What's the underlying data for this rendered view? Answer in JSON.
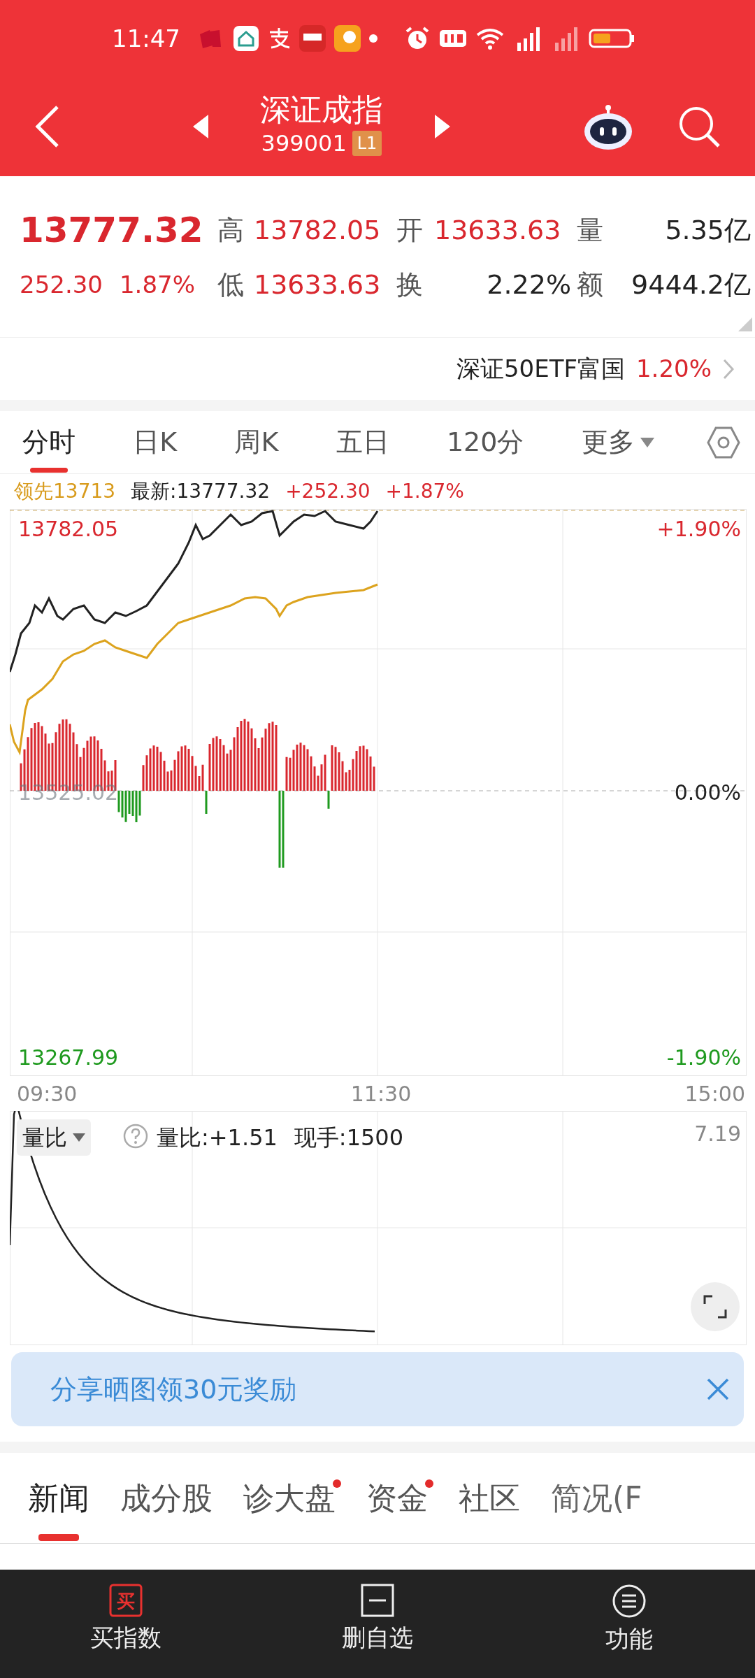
{
  "status_bar": {
    "time": "11:47"
  },
  "header": {
    "title": "深证成指",
    "code": "399001",
    "level_badge": "L1"
  },
  "quote": {
    "price": "13777.32",
    "change": "252.30",
    "change_pct": "1.87%",
    "stats": [
      {
        "label": "高",
        "value": "13782.05",
        "color": "#d9272e"
      },
      {
        "label": "开",
        "value": "13633.63",
        "color": "#d9272e"
      },
      {
        "label": "量",
        "value": "5.35亿",
        "color": "#222222"
      },
      {
        "label": "低",
        "value": "13633.63",
        "color": "#d9272e"
      },
      {
        "label": "换",
        "value": "2.22%",
        "color": "#222222"
      },
      {
        "label": "额",
        "value": "9444.2亿",
        "color": "#222222"
      }
    ]
  },
  "related_fund": {
    "name": "深证50ETF富国",
    "change": "1.20%"
  },
  "chart_tabs": [
    {
      "label": "分时",
      "selected": true,
      "dropdown": false
    },
    {
      "label": "日K",
      "selected": false,
      "dropdown": false
    },
    {
      "label": "周K",
      "selected": false,
      "dropdown": false
    },
    {
      "label": "五日",
      "selected": false,
      "dropdown": false
    },
    {
      "label": "120分",
      "selected": false,
      "dropdown": false
    },
    {
      "label": "更多",
      "selected": false,
      "dropdown": true
    }
  ],
  "chart_info": {
    "lead": "领先13713",
    "latest": "最新:13777.32",
    "change": "+252.30",
    "change_pct": "+1.87%"
  },
  "price_chart": {
    "high": "13782.05",
    "high_pct": "+1.90%",
    "base": "13525.02",
    "base_pct": "0.00%",
    "low": "13267.99",
    "low_pct": "-1.90%"
  },
  "time_axis": [
    "09:30",
    "11:30",
    "15:00"
  ],
  "volume_ratio": {
    "selector": "量比",
    "ratio": "量比:+1.51",
    "current_hands": "现手:1500",
    "max": "7.19"
  },
  "banner": {
    "text": "分享晒图领30元奖励"
  },
  "news_tabs": [
    {
      "label": "新闻",
      "selected": true,
      "badge": false
    },
    {
      "label": "成分股",
      "selected": false,
      "badge": false
    },
    {
      "label": "诊大盘",
      "selected": false,
      "badge": true
    },
    {
      "label": "资金",
      "selected": false,
      "badge": true
    },
    {
      "label": "社区",
      "selected": false,
      "badge": false
    },
    {
      "label": "简况(F",
      "selected": false,
      "badge": false
    }
  ],
  "bottom_nav": [
    {
      "label": "买指数",
      "kind": "buy",
      "icon_text": "买"
    },
    {
      "label": "删自选",
      "kind": "remove"
    },
    {
      "label": "功能",
      "kind": "menu"
    }
  ]
}
